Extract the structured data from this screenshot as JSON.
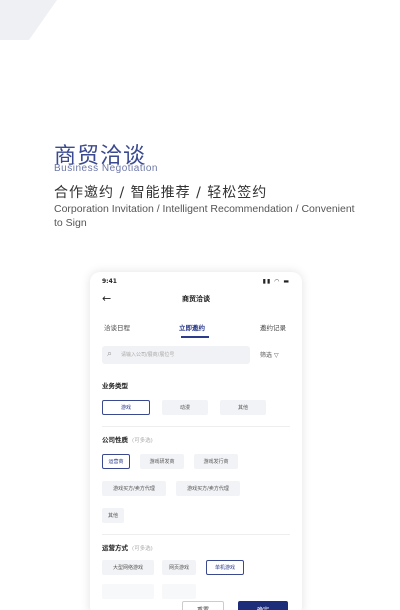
{
  "hero": {
    "title_cn": "商贸洽谈",
    "title_en": "Business Negotiation",
    "tagline": "合作邀约 / 智能推荐 /  轻松签约",
    "description": "Corporation Invitation / Intelligent Recommendation / Convenient to Sign"
  },
  "phone": {
    "status": {
      "time": "9:41",
      "icons": "▮▮ ◠ ▬"
    },
    "nav": {
      "title": "商贸洽谈",
      "back_icon": "arrow-left-icon"
    },
    "tabs": [
      {
        "label": "洽谈日程",
        "active": false
      },
      {
        "label": "立即邀约",
        "active": true
      },
      {
        "label": "邀约记录",
        "active": false
      }
    ],
    "search": {
      "placeholder": "请输入公司/展商/展位号",
      "filter_label": "筛选"
    },
    "sections": {
      "business_type": {
        "title": "业务类型",
        "options": [
          {
            "label": "游戏",
            "selected": true
          },
          {
            "label": "动漫",
            "selected": false
          },
          {
            "label": "其他",
            "selected": false
          }
        ]
      },
      "company_nature": {
        "title": "公司性质",
        "hint": "(可多选)",
        "options": [
          {
            "label": "运营商",
            "selected": true
          },
          {
            "label": "游戏研发商",
            "selected": false
          },
          {
            "label": "游戏发行商",
            "selected": false
          },
          {
            "label": "游戏买方/卖方代理",
            "selected": false
          },
          {
            "label": "游戏买方/卖方代理",
            "selected": false
          },
          {
            "label": "其他",
            "selected": false
          }
        ]
      },
      "operation_mode": {
        "title": "运营方式",
        "hint": "(可多选)",
        "options": [
          {
            "label": "大型网络游戏",
            "selected": false
          },
          {
            "label": "网页游戏",
            "selected": false
          },
          {
            "label": "单机游戏",
            "selected": true
          }
        ]
      }
    },
    "buttons": {
      "reset": "重置",
      "confirm": "确定"
    }
  }
}
